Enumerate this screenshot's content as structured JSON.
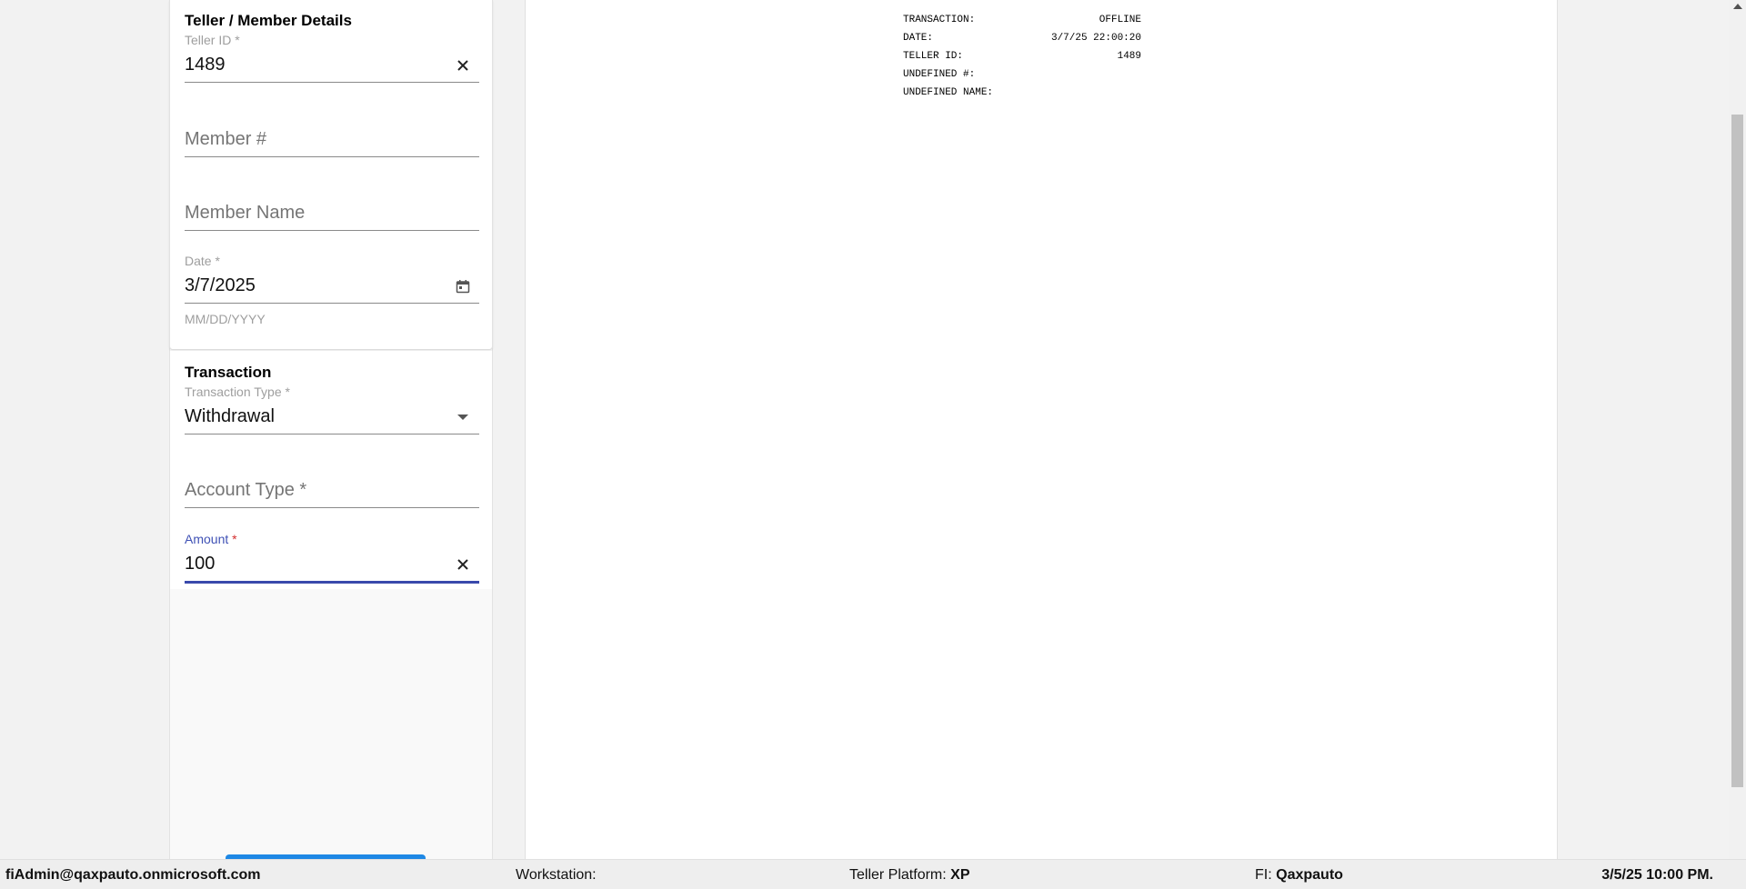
{
  "teller_member": {
    "title": "Teller / Member Details",
    "teller_id": {
      "label": "Teller ID",
      "required": "*",
      "value": "1489"
    },
    "member_number": {
      "placeholder": "Member #"
    },
    "member_name": {
      "placeholder": "Member Name"
    },
    "date": {
      "label": "Date",
      "required": "*",
      "value": "3/7/2025",
      "helper": "MM/DD/YYYY"
    }
  },
  "transaction": {
    "title": "Transaction",
    "transaction_type": {
      "label": "Transaction Type",
      "required": "*",
      "value": "Withdrawal"
    },
    "account_type": {
      "placeholder": "Account Type *"
    },
    "amount": {
      "label": "Amount",
      "required": "*",
      "value": "100"
    }
  },
  "receipt": {
    "rows": [
      {
        "label": "TRANSACTION:",
        "value": "OFFLINE"
      },
      {
        "label": "DATE:",
        "value": "3/7/25 22:00:20"
      },
      {
        "label": "TELLER ID:",
        "value": "1489"
      },
      {
        "label": "UNDEFINED #:",
        "value": ""
      },
      {
        "label": "UNDEFINED NAME:",
        "value": ""
      }
    ]
  },
  "status_bar": {
    "user": "fiAdmin@qaxpauto.onmicrosoft.com",
    "workstation_label": "Workstation:",
    "workstation_value": "",
    "platform_label": "Teller Platform:",
    "platform_value": "XP",
    "fi_label": "FI:",
    "fi_value": "Qaxpauto",
    "datetime": "3/5/25 10:00 PM."
  },
  "colors": {
    "focus": "#3949ab",
    "required": "#d32f2f",
    "primary_button": "#1e88e5"
  },
  "icons": {
    "clear": "close-icon",
    "calendar": "calendar-icon",
    "dropdown": "dropdown-arrow-icon"
  }
}
